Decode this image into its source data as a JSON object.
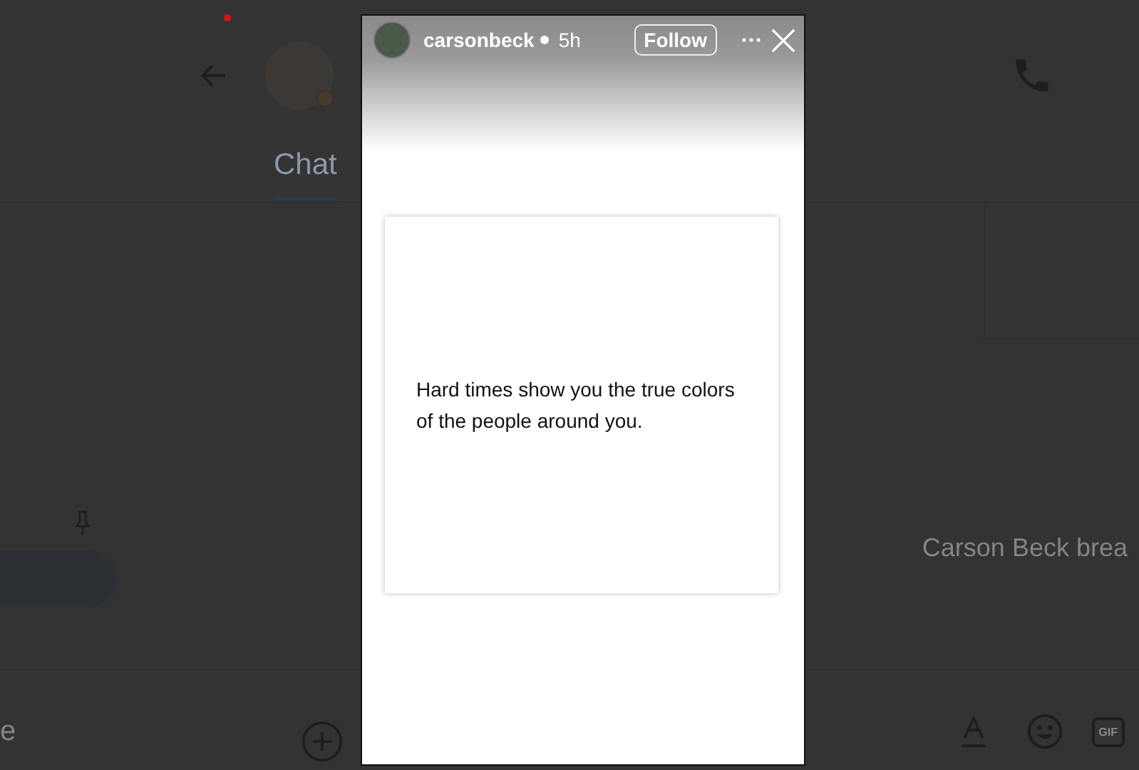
{
  "chat": {
    "tabs": [
      {
        "label": "Chat",
        "selected": true
      }
    ],
    "pinned_bubble": true,
    "message_preview": "Carson Beck brea",
    "composer_text": "e",
    "gif_label": "GIF"
  },
  "story": {
    "username": "carsonbeck",
    "time": "5h",
    "follow_label": "Follow",
    "quote": "Hard times show you the true colors of the people around you."
  }
}
